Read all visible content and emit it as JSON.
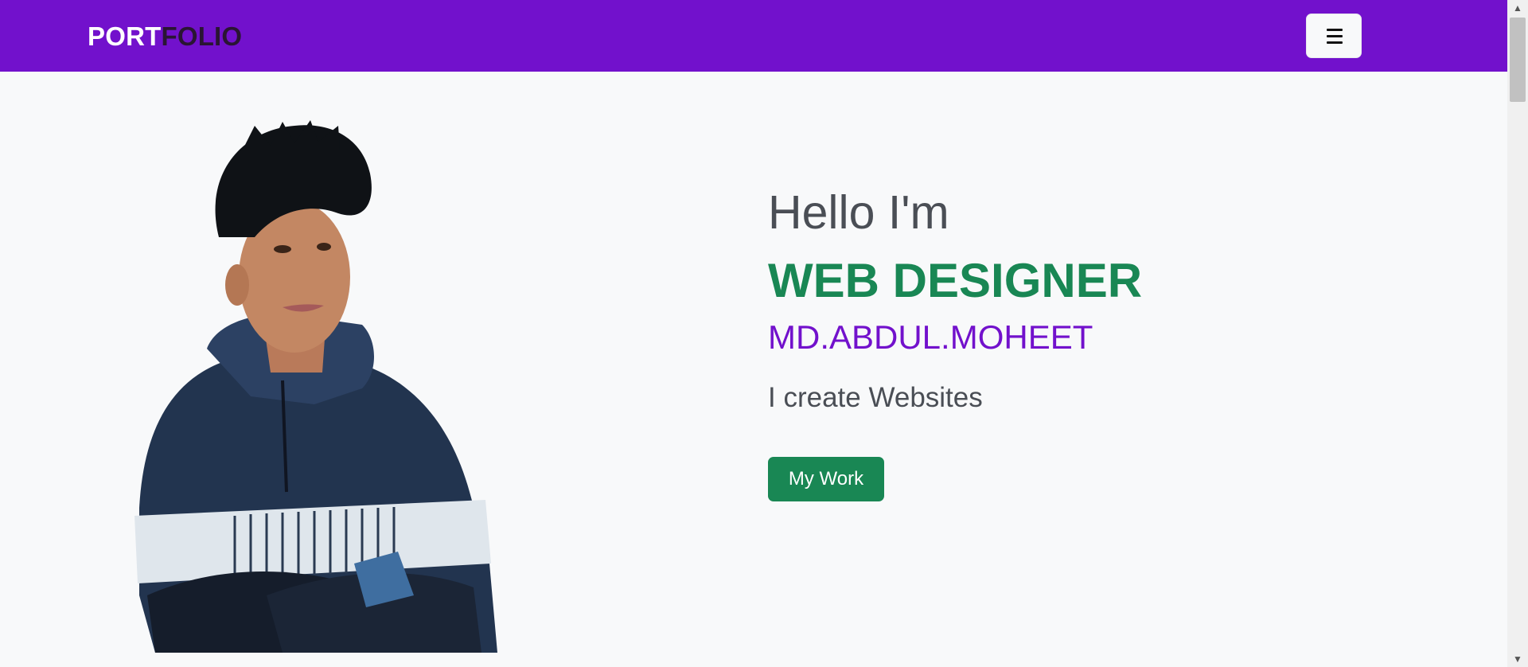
{
  "navbar": {
    "brand_part1": "PORT",
    "brand_part2": "FOLIO",
    "toggle_icon": "hamburger-menu-icon",
    "bg_color": "#7211cc"
  },
  "hero": {
    "greeting": "Hello I'm",
    "role": "WEB DESIGNER",
    "name": "MD.ABDUL.MOHEET",
    "tagline": "I create Websites",
    "cta_label": "My Work",
    "accent_green": "#198754",
    "accent_purple": "#7211cc"
  },
  "scrollbar": {
    "up_icon": "chevron-up-icon",
    "down_icon": "chevron-down-icon"
  }
}
